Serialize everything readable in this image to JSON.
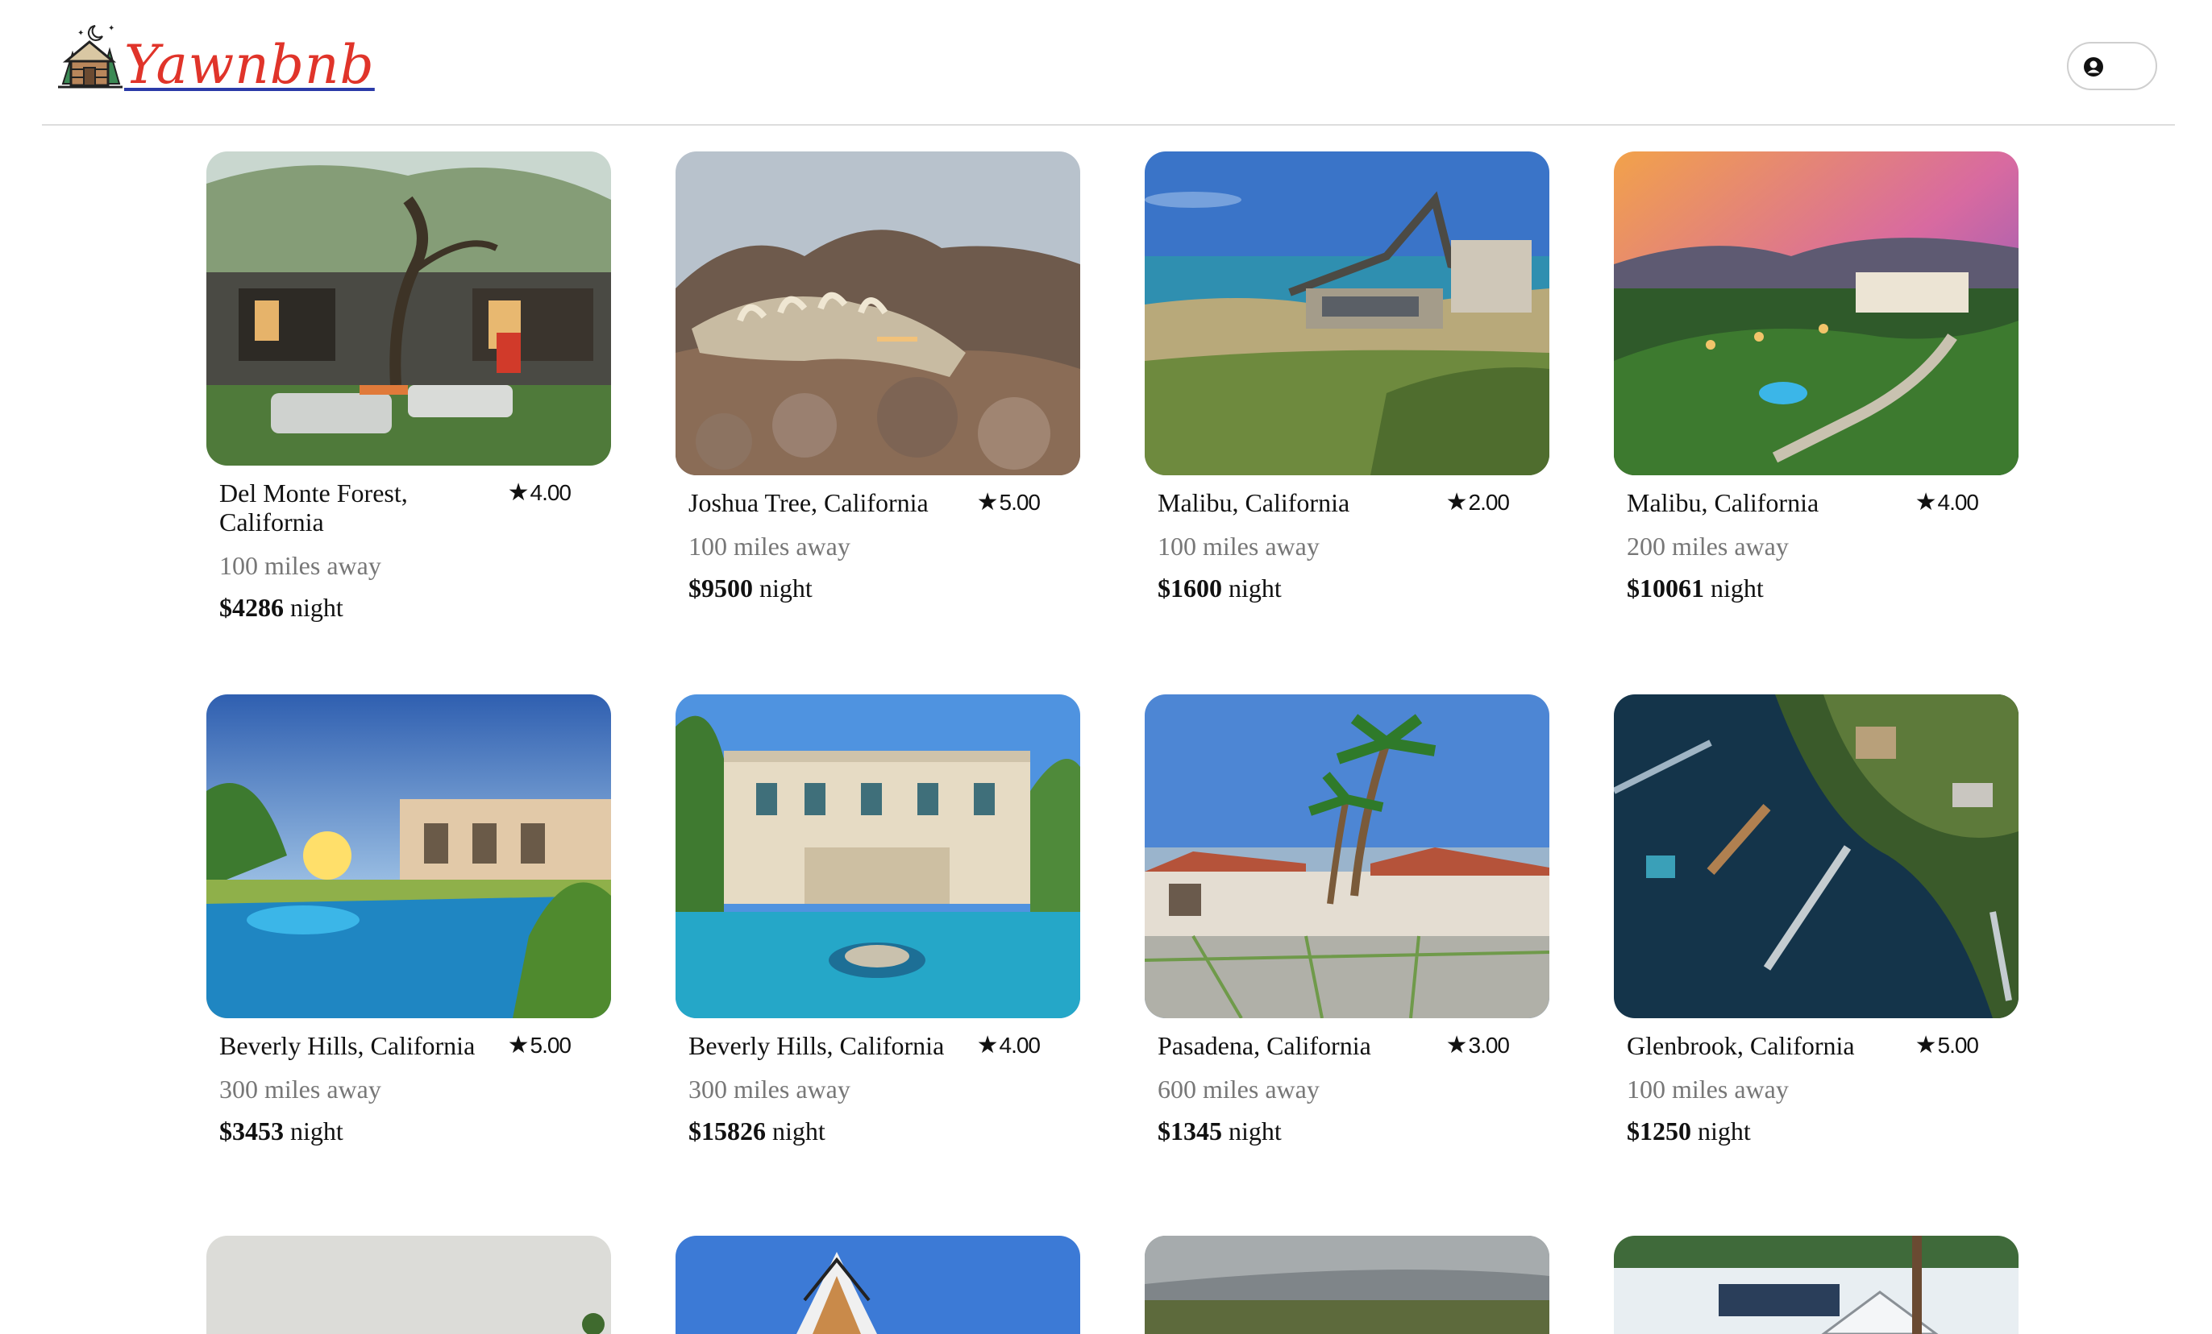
{
  "header": {
    "brand": "Yawnbnb",
    "logo_icon": "cabin-moon-logo",
    "profile_icon": "user-circle-icon"
  },
  "listings": [
    {
      "location": "Del Monte Forest, California",
      "rating": "4.00",
      "distance": "100 miles away",
      "price": "$4286",
      "unit": "night"
    },
    {
      "location": "Joshua Tree, California",
      "rating": "5.00",
      "distance": "100 miles away",
      "price": "$9500",
      "unit": "night"
    },
    {
      "location": "Malibu, California",
      "rating": "2.00",
      "distance": "100 miles away",
      "price": "$1600",
      "unit": "night"
    },
    {
      "location": "Malibu, California",
      "rating": "4.00",
      "distance": "200 miles away",
      "price": "$10061",
      "unit": "night"
    },
    {
      "location": "Beverly Hills, California",
      "rating": "5.00",
      "distance": "300 miles away",
      "price": "$3453",
      "unit": "night"
    },
    {
      "location": "Beverly Hills, California",
      "rating": "4.00",
      "distance": "300 miles away",
      "price": "$15826",
      "unit": "night"
    },
    {
      "location": "Pasadena, California",
      "rating": "3.00",
      "distance": "600 miles away",
      "price": "$1345",
      "unit": "night"
    },
    {
      "location": "Glenbrook, California",
      "rating": "5.00",
      "distance": "100 miles away",
      "price": "$1250",
      "unit": "night"
    }
  ],
  "colors": {
    "brand_text": "#e0342a",
    "brand_underline": "#2a3aa8",
    "muted_text": "#777777",
    "divider": "#dddddd"
  }
}
